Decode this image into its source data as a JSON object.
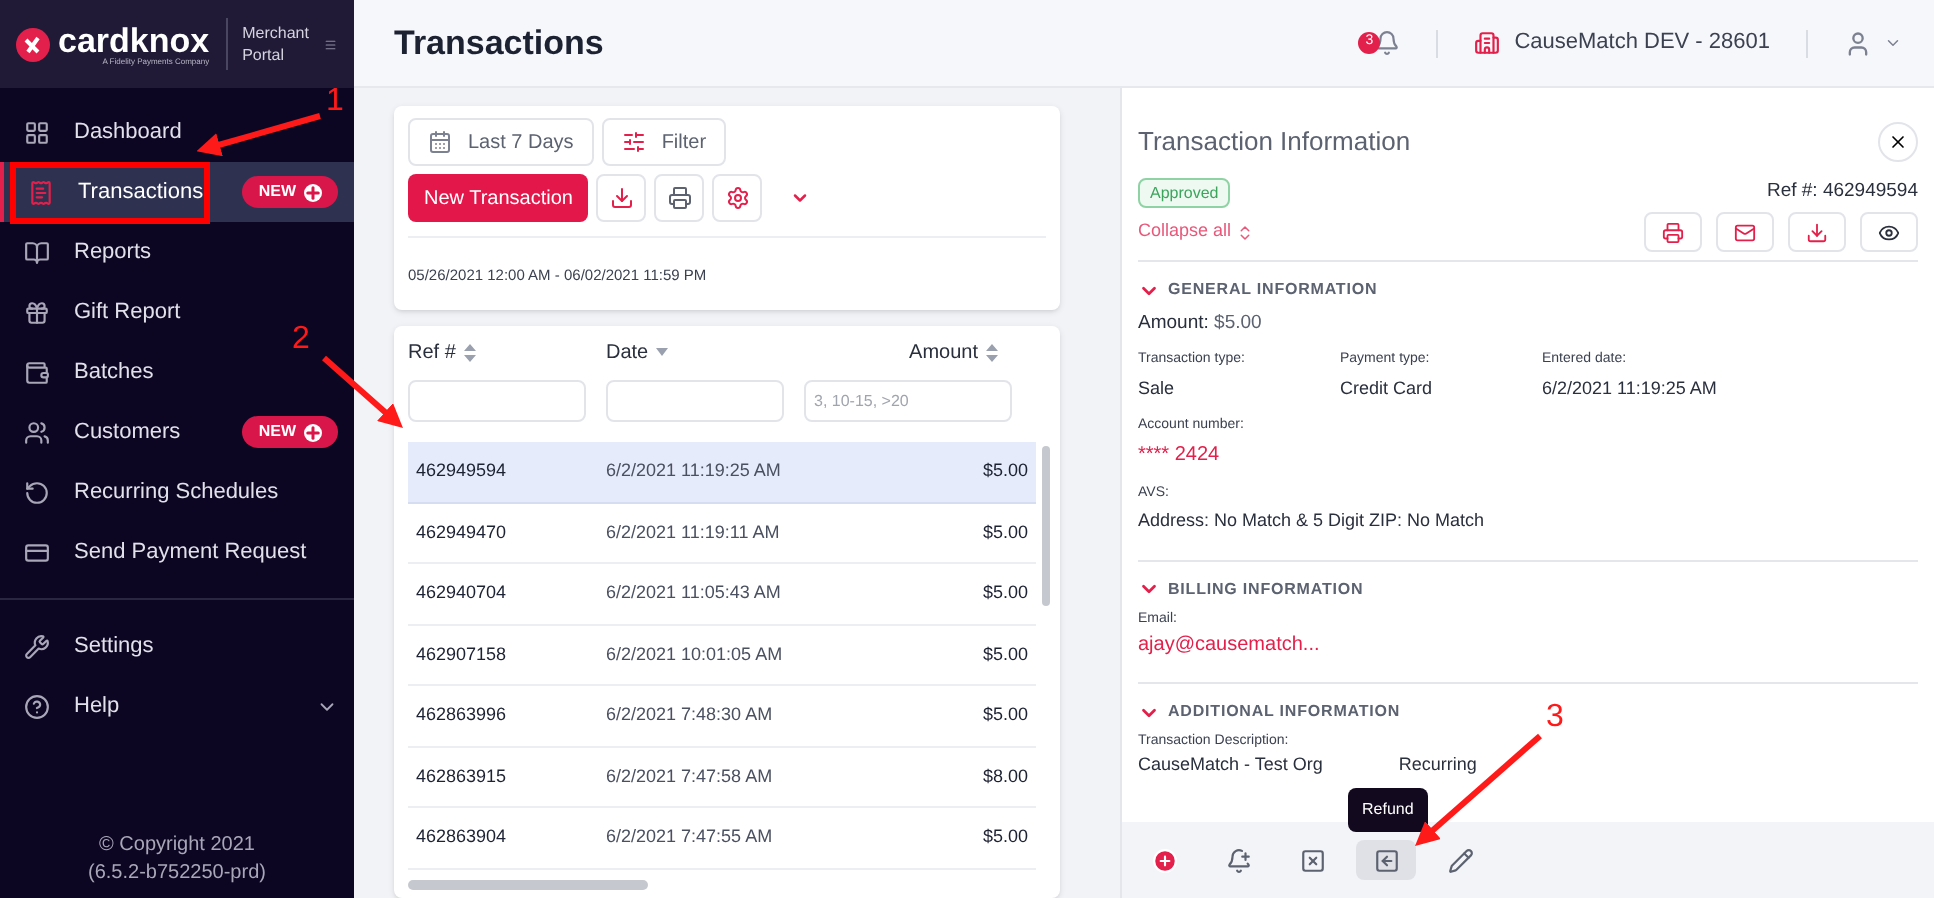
{
  "sidebar": {
    "logo": "cardknox",
    "logo_tagline": "A Fidelity Payments Company",
    "portal_label": "Merchant Portal",
    "items": [
      {
        "label": "Dashboard",
        "selected": false
      },
      {
        "label": "Transactions",
        "selected": true,
        "badge": "NEW"
      },
      {
        "label": "Reports",
        "selected": false
      },
      {
        "label": "Gift Report",
        "selected": false
      },
      {
        "label": "Batches",
        "selected": false
      },
      {
        "label": "Customers",
        "selected": false,
        "badge": "NEW"
      },
      {
        "label": "Recurring Schedules",
        "selected": false
      },
      {
        "label": "Send Payment Request",
        "selected": false
      }
    ],
    "footer_items": [
      {
        "label": "Settings",
        "selected": false
      },
      {
        "label": "Help",
        "selected": false,
        "expanded": false
      }
    ],
    "copyright": [
      "© Copyright 2021",
      "(6.5.2-b752250-prd)"
    ]
  },
  "header": {
    "title": "Transactions",
    "notification_count": "3",
    "account": "CauseMatch DEV - 28601"
  },
  "toolbar": {
    "date_range": "Last 7 Days",
    "filter": "Filter",
    "new_button": "New Transaction",
    "range_text": "05/26/2021 12:00 AM - 06/02/2021 11:59 PM"
  },
  "table": {
    "columns": [
      {
        "label": "Ref #",
        "sorted": false
      },
      {
        "label": "Date",
        "sorted": true
      },
      {
        "label": "Amount",
        "sorted": false,
        "filter_placeholder": "3, 10-15, >20"
      }
    ],
    "rows": [
      {
        "ref": "462949594",
        "date": "6/2/2021 11:19:25 AM",
        "amount": "$5.00",
        "selected": true
      },
      {
        "ref": "462949470",
        "date": "6/2/2021 11:19:11 AM",
        "amount": "$5.00",
        "selected": false
      },
      {
        "ref": "462940704",
        "date": "6/2/2021 11:05:43 AM",
        "amount": "$5.00",
        "selected": false
      },
      {
        "ref": "462907158",
        "date": "6/2/2021 10:01:05 AM",
        "amount": "$5.00",
        "selected": false
      },
      {
        "ref": "462863996",
        "date": "6/2/2021 7:48:30 AM",
        "amount": "$5.00",
        "selected": false
      },
      {
        "ref": "462863915",
        "date": "6/2/2021 7:47:58 AM",
        "amount": "$8.00",
        "selected": false
      },
      {
        "ref": "462863904",
        "date": "6/2/2021 7:47:55 AM",
        "amount": "$5.00",
        "selected": false
      }
    ]
  },
  "details": {
    "title": "Transaction Information",
    "status": "Approved",
    "ref": "Ref #: 462949594",
    "collapse_all": "Collapse all",
    "general": {
      "title": "GENERAL INFORMATION",
      "expanded": true,
      "amount_label": "Amount:",
      "amount": "$5.00",
      "fields": [
        {
          "label": "Transaction type:",
          "value": "Sale"
        },
        {
          "label": "Payment type:",
          "value": "Credit Card"
        },
        {
          "label": "Entered date:",
          "value": "6/2/2021 11:19:25 AM"
        }
      ],
      "account": {
        "label": "Account number:",
        "value": "**** 2424"
      },
      "avs": {
        "label": "AVS:",
        "value": "Address: No Match & 5 Digit ZIP: No Match"
      }
    },
    "billing": {
      "title": "BILLING INFORMATION",
      "expanded": true,
      "email_label": "Email:",
      "email": "ajay@causematch..."
    },
    "additional": {
      "title": "ADDITIONAL INFORMATION",
      "expanded": true,
      "description_label": "Transaction Description:",
      "description_start": "CauseMatch - Test Org",
      "description_end": "Recurring"
    },
    "actions": [
      {
        "selected": false
      },
      {
        "selected": false
      },
      {
        "selected": false
      },
      {
        "selected": true,
        "tooltip": "Refund"
      },
      {
        "selected": false
      }
    ]
  },
  "annotations": [
    {
      "number": "1"
    },
    {
      "number": "2"
    },
    {
      "number": "3"
    }
  ]
}
